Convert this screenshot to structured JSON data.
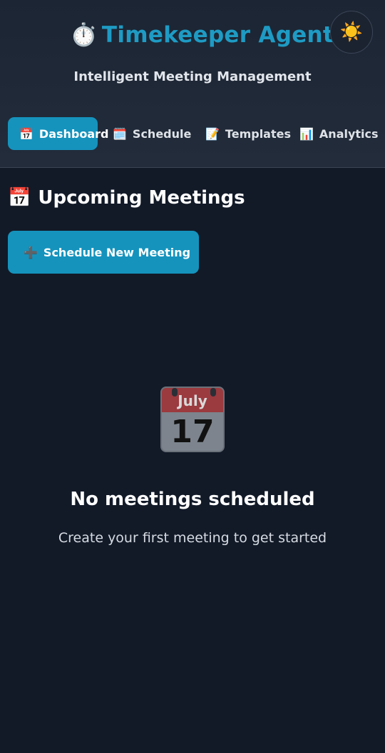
{
  "header": {
    "app_icon": "stopwatch-icon",
    "app_icon_glyph": "⏱️",
    "title": "Timekeeper Agent",
    "subtitle": "Intelligent Meeting Management",
    "theme_toggle_glyph": "☀️"
  },
  "nav": {
    "items": [
      {
        "icon": "calendar-icon",
        "glyph": "📅",
        "label": "Dashboard",
        "active": true
      },
      {
        "icon": "spiral-calendar-icon",
        "glyph": "🗓️",
        "label": "Schedule",
        "active": false
      },
      {
        "icon": "memo-icon",
        "glyph": "📝",
        "label": "Templates",
        "active": false
      },
      {
        "icon": "bar-chart-icon",
        "glyph": "📊",
        "label": "Analytics",
        "active": false
      }
    ]
  },
  "main": {
    "section_icon_glyph": "📅",
    "section_title": "Upcoming Meetings",
    "schedule_button_glyph": "➕",
    "schedule_button_label": "Schedule New Meeting",
    "empty_state": {
      "calendar_month": "July",
      "calendar_day": "17",
      "title": "No meetings scheduled",
      "message": "Create your first meeting to get started"
    }
  },
  "colors": {
    "accent": "#1593bd",
    "title": "#1e9bc4",
    "background": "#121a28"
  }
}
